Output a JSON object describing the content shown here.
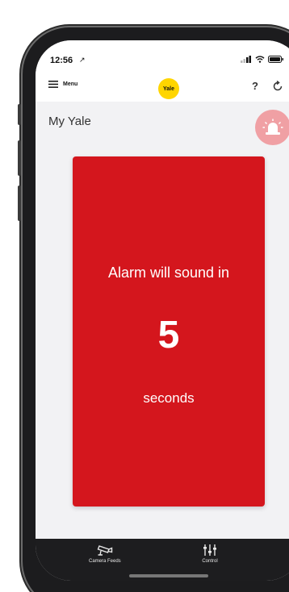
{
  "status_bar": {
    "time": "12:56",
    "location_glyph": "↗"
  },
  "header": {
    "menu_label": "Menu",
    "logo_text": "Yale",
    "help_label": "?"
  },
  "page": {
    "title": "My Yale"
  },
  "alarm": {
    "message": "Alarm will sound in",
    "countdown": "5",
    "unit": "seconds",
    "card_color": "#d4161d"
  },
  "bottom_nav": {
    "items": [
      {
        "label": "Camera Feeds",
        "icon": "camera-icon"
      },
      {
        "label": "Control",
        "icon": "sliders-icon"
      }
    ]
  },
  "colors": {
    "brand_yellow": "#ffd500",
    "alarm_red": "#d4161d",
    "alarm_fab": "#f0a0a4"
  }
}
